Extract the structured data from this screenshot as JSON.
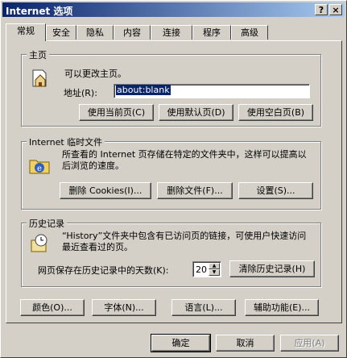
{
  "titlebar": {
    "title": "Internet 选项",
    "help": "?",
    "close": "×"
  },
  "tabs": [
    "常规",
    "安全",
    "隐私",
    "内容",
    "连接",
    "程序",
    "高级"
  ],
  "home": {
    "group_title": "主页",
    "desc": "可以更改主页。",
    "addr_label": "地址(R):",
    "addr_value": "about:blank",
    "btn_current": "使用当前页(C)",
    "btn_default": "使用默认页(D)",
    "btn_blank": "使用空白页(B)"
  },
  "temp": {
    "group_title": "Internet 临时文件",
    "desc": "所查看的 Internet 页存储在特定的文件夹中，这样可以提高以后浏览的速度。",
    "btn_cookies": "删除 Cookies(I)...",
    "btn_files": "删除文件(F)...",
    "btn_settings": "设置(S)..."
  },
  "history": {
    "group_title": "历史记录",
    "desc": "“History”文件夹中包含有已访问页的链接，可使用户快速访问最近查看过的页。",
    "days_label": "网页保存在历史记录中的天数(K):",
    "days_value": "20",
    "btn_clear": "清除历史记录(H)"
  },
  "bottom_buttons": {
    "colors": "颜色(O)...",
    "fonts": "字体(N)...",
    "languages": "语言(L)...",
    "accessibility": "辅助功能(E)..."
  },
  "dialog_buttons": {
    "ok": "确定",
    "cancel": "取消",
    "apply": "应用(A)"
  }
}
